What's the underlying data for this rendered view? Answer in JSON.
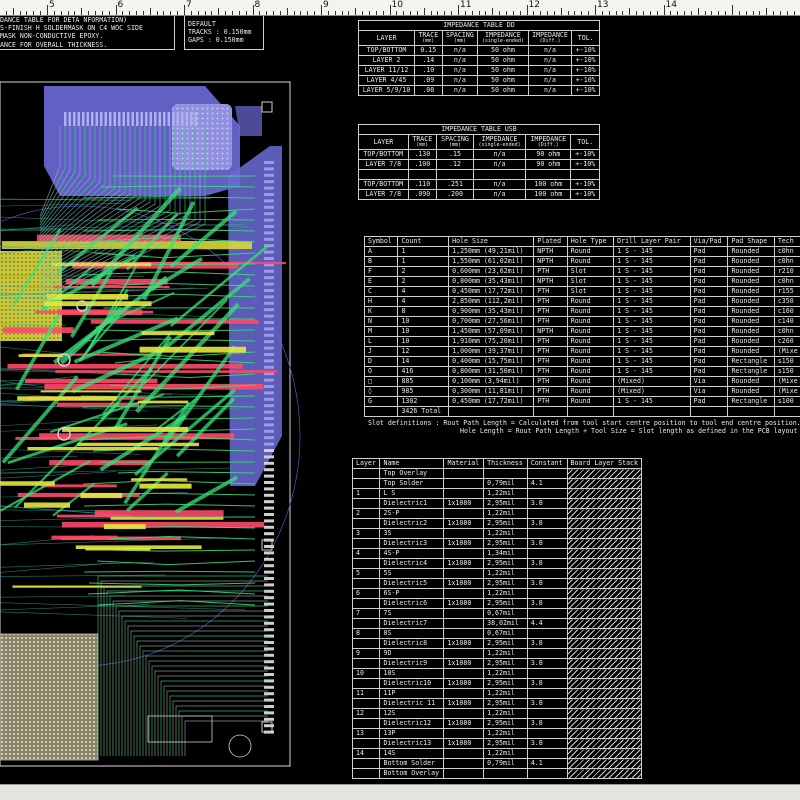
{
  "ruler": {
    "labels": [
      "5",
      "6",
      "7",
      "8",
      "9",
      "10",
      "11",
      "12",
      "13",
      "14"
    ]
  },
  "top_left_notes": {
    "lines": [
      "DANCE TABLE FOR DETA  NFORMATION)",
      "S-FINISH H SOLDERMASK ON C4 WOC SIDE",
      "MASK    NON-CONDUCTIVE EPOXY.",
      "ANCE FOR OVERALL THICKNESS."
    ]
  },
  "default_box": {
    "lines": [
      "DEFAULT",
      "TRACKS : 0.150mm",
      "GAPS : 0.150mm"
    ]
  },
  "impedance_table_1": {
    "title": "IMPEDANCE TABLE  DD",
    "headers": [
      "LAYER",
      "TRACE",
      "SPACING",
      "IMPEDANCE",
      "IMPEDANCE",
      "TOL."
    ],
    "units": [
      "",
      "(mm)",
      "(mm)",
      "(single-ended)",
      "(Diff.)",
      ""
    ],
    "rows": [
      [
        "TOP/BOTTOM",
        "0.15",
        "n/a",
        "50 ohm",
        "n/a",
        "+-10%"
      ],
      [
        "LAYER 2",
        ".14",
        "n/a",
        "50 ohm",
        "n/a",
        "+-10%"
      ],
      [
        "LAYER 11/12",
        ".10",
        "n/a",
        "50 ohm",
        "n/a",
        "+-10%"
      ],
      [
        "LAYER 4/45",
        ".09",
        "n/a",
        "50 ohm",
        "n/a",
        "+-10%"
      ],
      [
        "LAYER 5/9/10",
        ".08",
        "n/a",
        "50 ohm",
        "n/a",
        "+-10%"
      ]
    ]
  },
  "impedance_table_2": {
    "title": "IMPEDANCE TABLE  USB",
    "headers": [
      "LAYER",
      "TRACE",
      "SPACING",
      "IMPEDANCE",
      "IMPEDANCE",
      "TOL."
    ],
    "units": [
      "",
      "(mm)",
      "(mm)",
      "(single-ended)",
      "(Diff.)",
      ""
    ],
    "rows": [
      [
        "TOP/BOTTOM",
        ".130",
        ".15",
        "n/a",
        "90 ohm",
        "+-10%"
      ],
      [
        "LAYER 7/8",
        ".100",
        ".12",
        "n/a",
        "90 ohm",
        "+-10%"
      ],
      [
        "",
        "",
        "",
        "",
        "",
        ""
      ],
      [
        "TOP/BOTTOM",
        ".110",
        ".251",
        "n/a",
        "100 ohm",
        "+-10%"
      ],
      [
        "LAYER 7/8",
        ".090",
        ".200",
        "n/a",
        "100 ohm",
        "+-10%"
      ]
    ]
  },
  "drill_table": {
    "headers": [
      "Symbol",
      "Count",
      "Hole Size",
      "Plated",
      "Hole Type",
      "Drill Layer Pair",
      "Via/Pad",
      "Pad Shape",
      "Tech"
    ],
    "rows": [
      [
        "A",
        "1",
        "1,250mm (49,21mil)",
        "NPTH",
        "Round",
        "1 S - 145",
        "Pad",
        "Rounded",
        "c0hn"
      ],
      [
        "B",
        "1",
        "1,550mm (61,02mil)",
        "NPTH",
        "Round",
        "1 S - 145",
        "Pad",
        "Rounded",
        "c0hn"
      ],
      [
        "F",
        "2",
        "0,600mm (23,62mil)",
        "PTH",
        "Slot",
        "1 S - 145",
        "Pad",
        "Rounded",
        "r210"
      ],
      [
        "E",
        "2",
        "0,800mm (35,43mil)",
        "NPTH",
        "Slot",
        "1 S - 145",
        "Pad",
        "Rounded",
        "c0hn"
      ],
      [
        "C",
        "4",
        "0,450mm (17,72mil)",
        "PTH",
        "Slot",
        "1 S - 145",
        "Pad",
        "Rounded",
        "r155"
      ],
      [
        "H",
        "4",
        "2,850mm (112,2mil)",
        "PTH",
        "Round",
        "1 S - 145",
        "Pad",
        "Rounded",
        "c350"
      ],
      [
        "K",
        "8",
        "0,900mm (35,43mil)",
        "PTH",
        "Round",
        "1 S - 145",
        "Pad",
        "Rounded",
        "c160"
      ],
      [
        "N",
        "10",
        "0,700mm (27,56mil)",
        "PTH",
        "Round",
        "1 S - 145",
        "Pad",
        "Rounded",
        "c140"
      ],
      [
        "M",
        "10",
        "1,450mm (57,09mil)",
        "NPTH",
        "Round",
        "1 S - 145",
        "Pad",
        "Rounded",
        "c0hn"
      ],
      [
        "L",
        "10",
        "1,910mm (75,20mil)",
        "PTH",
        "Round",
        "1 S - 145",
        "Pad",
        "Rounded",
        "c260"
      ],
      [
        "J",
        "12",
        "1,000mm (39,37mil)",
        "PTH",
        "Round",
        "1 S - 145",
        "Pad",
        "Rounded",
        "(Mixe"
      ],
      [
        "D",
        "14",
        "0,400mm (15,75mil)",
        "PTH",
        "Round",
        "1 S - 145",
        "Pad",
        "Rectangle",
        "s150"
      ],
      [
        "O",
        "416",
        "0,800mm (31,50mil)",
        "PTH",
        "Round",
        "1 S - 145",
        "Pad",
        "Rectangle",
        "s150"
      ],
      [
        "□",
        "885",
        "0,100mm (3,94mil)",
        "PTH",
        "Round",
        "(Mixed)",
        "Via",
        "Rounded",
        "(Mixe"
      ],
      [
        "◊",
        "985",
        "0,300mm (11,81mil)",
        "PTH",
        "Round",
        "(Mixed)",
        "Via",
        "Rounded",
        "(Mixe"
      ],
      [
        "G",
        "1302",
        "0,450mm (17,72mil)",
        "PTH",
        "Round",
        "1 S - 145",
        "Pad",
        "Rectangle",
        "s100"
      ],
      [
        "",
        "3426 Total",
        "",
        "",
        "",
        "",
        "",
        "",
        ""
      ]
    ],
    "notes": [
      "Slot definitions : Rout Path Length = Calculated from tool start centre position to tool end centre position.",
      "Hole Length  = Rout Path Length + Tool Size = Slot length as defined in the PCB layout"
    ]
  },
  "layer_stack": {
    "headers": [
      "Layer",
      "Name",
      "Material",
      "Thickness",
      "Constant",
      "Board Layer Stack"
    ],
    "rows": [
      [
        "",
        "Top Overlay",
        "",
        "",
        "",
        ""
      ],
      [
        "",
        "Top Solder",
        "",
        "0,79mil",
        "4.1",
        ""
      ],
      [
        "1",
        "L S",
        "",
        "1,22mil",
        "",
        ""
      ],
      [
        "",
        "Dielectric1",
        "1x1080",
        "2,95mil",
        "3.8",
        ""
      ],
      [
        "2",
        "2S-P",
        "",
        "1,22mil",
        "",
        ""
      ],
      [
        "",
        "Dielectric2",
        "1x1080",
        "2,95mil",
        "3.8",
        ""
      ],
      [
        "3",
        "3S",
        "",
        "1,22mil",
        "",
        ""
      ],
      [
        "",
        "Dielectric3",
        "1x1080",
        "2,95mil",
        "3.8",
        ""
      ],
      [
        "4",
        "4S-P",
        "",
        "1,34mil",
        "",
        ""
      ],
      [
        "",
        "Dielectric4",
        "1x1080",
        "2,95mil",
        "3.8",
        ""
      ],
      [
        "5",
        "5S",
        "",
        "1,22mil",
        "",
        ""
      ],
      [
        "",
        "Dielectric5",
        "1x1080",
        "2,95mil",
        "3.8",
        ""
      ],
      [
        "6",
        "6S-P",
        "",
        "1,22mil",
        "",
        ""
      ],
      [
        "",
        "Dielectric6",
        "1x1080",
        "2,95mil",
        "3.8",
        ""
      ],
      [
        "7",
        "7S",
        "",
        "0,67mil",
        "",
        ""
      ],
      [
        "",
        "Dielectric7",
        "",
        "38,02mil",
        "4.4",
        ""
      ],
      [
        "8",
        "8S",
        "",
        "0,67mil",
        "",
        ""
      ],
      [
        "",
        "Dielectric8",
        "1x1080",
        "2,95mil",
        "3.8",
        ""
      ],
      [
        "9",
        "9D",
        "",
        "1,22mil",
        "",
        ""
      ],
      [
        "",
        "Dielectric9",
        "1x1080",
        "2,95mil",
        "3.8",
        ""
      ],
      [
        "10",
        "10S",
        "",
        "1,22mil",
        "",
        ""
      ],
      [
        "",
        "Dielectric10",
        "1x1080",
        "2,95mil",
        "3.8",
        ""
      ],
      [
        "11",
        "11P",
        "",
        "1,22mil",
        "",
        ""
      ],
      [
        "",
        "Dielectric 11",
        "1x1080",
        "2,95mil",
        "3.8",
        ""
      ],
      [
        "12",
        "12S",
        "",
        "1,22mil",
        "",
        ""
      ],
      [
        "",
        "Dielectric12",
        "1x1080",
        "2,95mil",
        "3.8",
        ""
      ],
      [
        "13",
        "13P",
        "",
        "1,22mil",
        "",
        ""
      ],
      [
        "",
        "Dielectric13",
        "1x1080",
        "2,95mil",
        "3.8",
        ""
      ],
      [
        "14",
        "14S",
        "",
        "1,22mil",
        "",
        ""
      ],
      [
        "",
        "Bottom Solder",
        "",
        "0,79mil",
        "4.1",
        ""
      ],
      [
        "",
        "Bottom Overlay",
        "",
        "",
        "",
        ""
      ]
    ]
  },
  "colors": {
    "background": "#000000",
    "board_outline": "#d8d8d8",
    "trace_green": "#39e27a",
    "trace_red": "#ff4a6a",
    "trace_yellow": "#e6ea3c",
    "plane_purple": "#7876e0",
    "trace_teal": "#3aa89a"
  }
}
